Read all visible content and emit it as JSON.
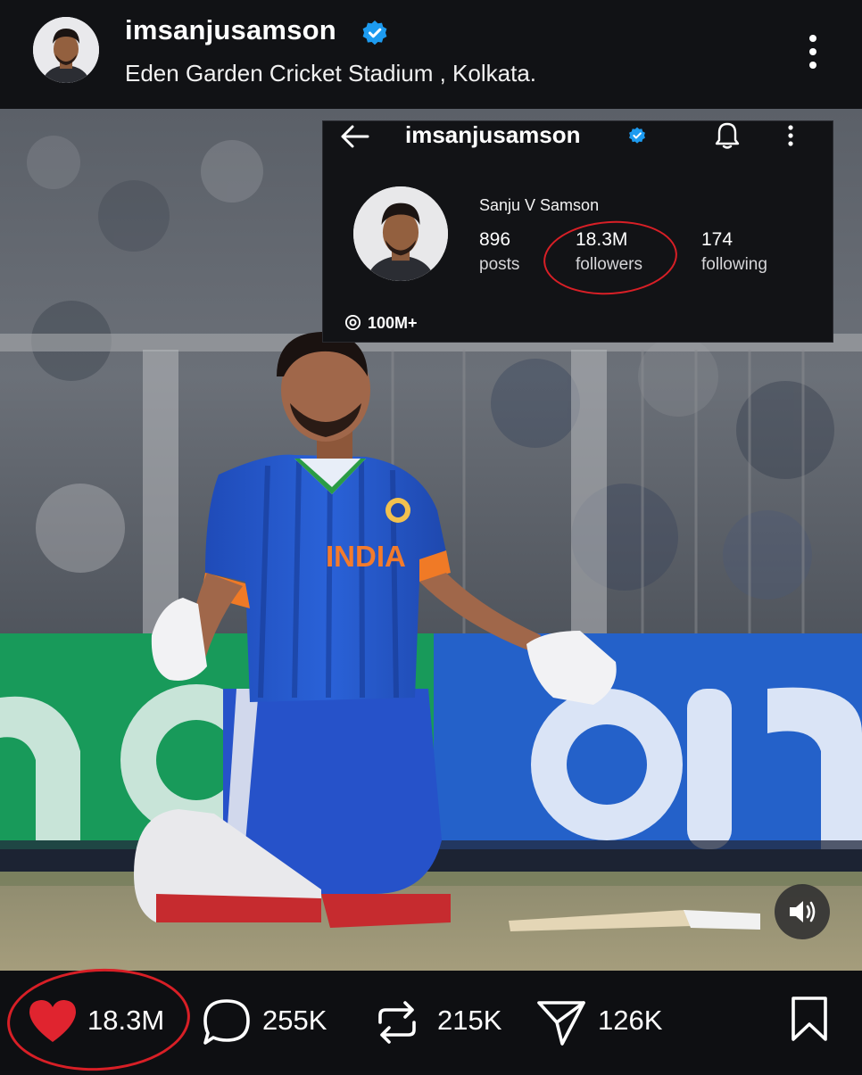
{
  "post": {
    "username": "imsanjusamson",
    "location": "Eden Garden Cricket Stadium , Kolkata."
  },
  "inset": {
    "username": "imsanjusamson",
    "full_name": "Sanju V Samson",
    "stats": [
      {
        "value": "896",
        "label": "posts"
      },
      {
        "value": "18.3M",
        "label": "followers"
      },
      {
        "value": "174",
        "label": "following"
      }
    ],
    "threads_count": "100M+"
  },
  "photo_text": {
    "jersey": "INDIA"
  },
  "actions": {
    "likes": "18.3M",
    "comments": "255K",
    "reposts": "215K",
    "shares": "126K"
  },
  "colors": {
    "accent_verified": "#1d9bf0",
    "like": "#e0242f",
    "annotation_circle": "#d81f26"
  },
  "icons": {
    "verified": "verified-badge-icon",
    "more": "more-vertical-icon",
    "back": "back-arrow-icon",
    "bell": "bell-icon",
    "threads": "threads-icon",
    "volume": "volume-icon",
    "like": "heart-icon",
    "comment": "comment-icon",
    "repost": "repost-icon",
    "share": "share-icon",
    "save": "bookmark-icon"
  }
}
